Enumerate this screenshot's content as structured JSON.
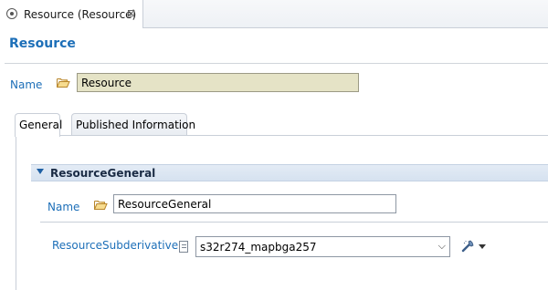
{
  "editor_tab": {
    "title": "Resource (Resource)",
    "close_symbol": "⊠"
  },
  "page": {
    "title": "Resource"
  },
  "main_form": {
    "name_label": "Name",
    "name_value": "Resource"
  },
  "subtabs": [
    {
      "label": "General",
      "selected": true
    },
    {
      "label": "Published Information",
      "selected": false
    }
  ],
  "section": {
    "title": "ResourceGeneral",
    "expanded": true,
    "name_label": "Name",
    "name_value": "ResourceGeneral",
    "subderivative_label": "ResourceSubderivative",
    "subderivative_value": "s32r274_mapbga257"
  },
  "icons": {
    "editor_tab": "resource-icon",
    "folder": "folder-open-icon",
    "document": "document-icon",
    "action": "wand-action-icon"
  },
  "colors": {
    "accent": "#1d6fb8",
    "name_field_bg": "#e5e3c6",
    "section_header_bg": "#dde7f3"
  }
}
